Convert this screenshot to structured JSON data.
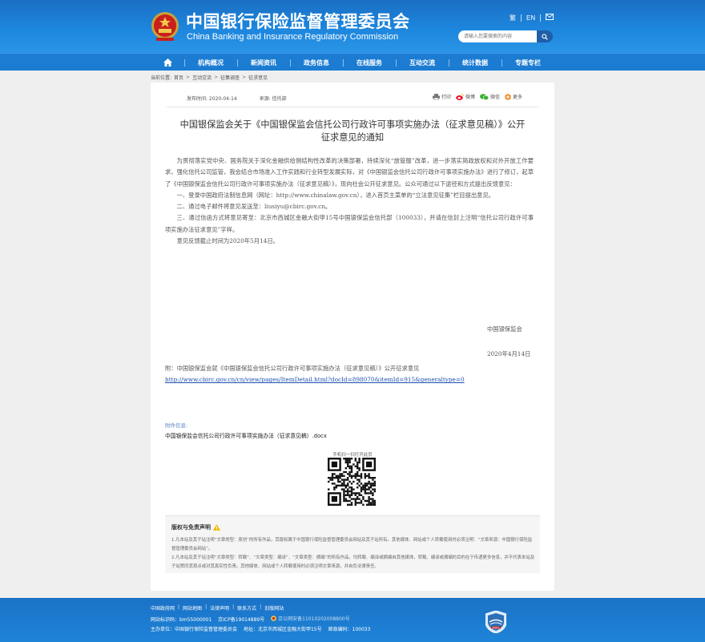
{
  "header": {
    "title_cn": "中国银行保险监督管理委员会",
    "title_en": "China Banking and Insurance Regulatory Commission",
    "tools": [
      "繁",
      "EN"
    ],
    "search_placeholder": "请输入您要搜索的内容"
  },
  "nav": {
    "items": [
      "机构概况",
      "新闻资讯",
      "政务信息",
      "在线服务",
      "互动交流",
      "统计数据",
      "专题专栏"
    ]
  },
  "breadcrumb": {
    "label": "当前位置:",
    "items": [
      "首页",
      "互动交流",
      "征集调查",
      "征求意见"
    ],
    "sep": ">"
  },
  "article": {
    "publish_time": "发布时间: 2020-04-14",
    "source": "来源: 信托部",
    "share": [
      "打印",
      "微博",
      "微信",
      "更多"
    ],
    "title_line1": "中国银保监会关于《中国银保监会信托公司行政许可事项实施办法（征求意见稿）》公开",
    "title_line2": "征求意见的通知",
    "paragraphs": [
      "为贯彻落实党中央、国务院关于深化金融供给侧结构性改革的决策部署，持续深化“放管服”改革，进一步落实简政放权和对外开放工作要求，强化信托公司监管，我会结合市场准入工作实践和行业转型发展实际，对《中国银监会信托公司行政许可事项实施办法》进行了修订，起草了《中国银保监会信托公司行政许可事项实施办法（征求意见稿）》，现向社会公开征求意见。公众可通过以下途径和方式提出反馈意见：",
      "一、登录中国政府法制信息网（网址：http://www.chinalaw.gov.cn），进入首页主菜单的“立法意见征集”栏目提出意见。",
      "二、通过电子邮件将意见发送至：liusiyu@cbirc.gov.cn。",
      "三、通过信函方式将意见寄至：北京市西城区金融大街甲15号中国银保监会信托部（100033），并请在信封上注明“信托公司行政许可事项实施办法征求意见”字样。",
      "意见反馈截止时间为2020年5月14日。"
    ],
    "signature": "中国银保监会",
    "date": "2020年4月14日",
    "attachment_note": "附：中国银保监会就《中国银保监会信托公司行政许可事项实施办法（征求意见稿）》公开征求意见",
    "attachment_url": "http://www.cbirc.gov.cn/cn/view/pages/ItemDetail.html?docId=898070&itemId=915&generaltype=0",
    "attachments_label": "附件信息:",
    "attachment_file": "中国银保监会信托公司行政许可事项实施办法（征求意见稿）.docx",
    "qr_caption": "手机扫一扫打开此页"
  },
  "notice": {
    "title": "版权与免责声明",
    "lines": [
      "1.凡本站及其子站注明“文章类型：原创”的所有作品，其版权属于中国银行保险监督管理委员会网站及其子站所有。其他媒体、网站或个人转载使用时必须注明：“文章来源：中国银行保险监督管理委员会网站”。",
      "2.凡本站及其子站注明“文章类型：转载”、“文章类型：编译”、“文章类型：摘编”的所有作品，均转载、编译或摘编自其他媒体，转载、编译或摘编的目的在于传递更多信息，并不代表本站及子站赞同其观点或对其真实性负责。其他媒体、网站或个人转载使用时必须注明文章来源，并自负法律责任。"
    ]
  },
  "footer": {
    "links": [
      "中国政府网",
      "网站地图",
      "法律声明",
      "联系方式",
      "旧版网站"
    ],
    "identifier": "网站标识码：bm55000001",
    "icp": "京ICP备19014889号",
    "police": "京公网安备11010202008800号",
    "host": "主办单位：中国银行保险监督管理委员会",
    "address": "地址：北京市西城区金融大街甲15号",
    "postcode": "邮政编码：100033",
    "badge_text": "党政机关"
  },
  "colors": {
    "header_blue": "#1d86dd",
    "nav_blue": "#1b7cd2",
    "link_blue": "#1d4fb0",
    "label_blue": "#5b86c4"
  }
}
